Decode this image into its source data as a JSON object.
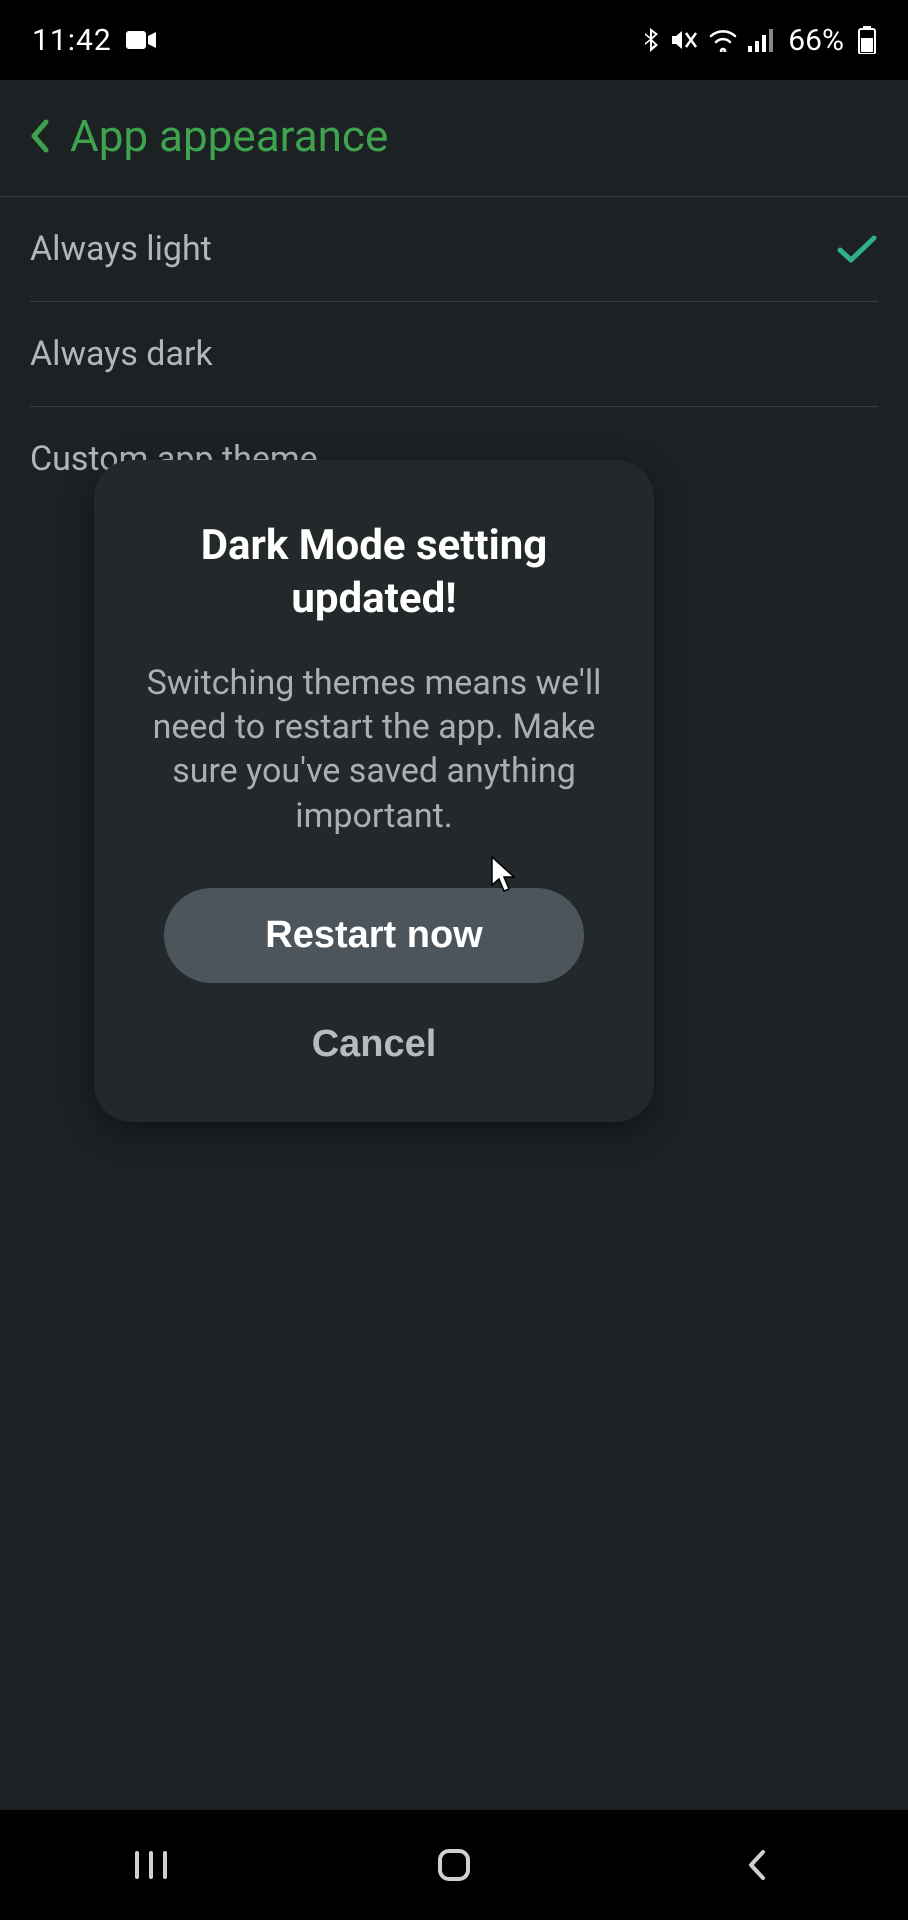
{
  "status_bar": {
    "time": "11:42",
    "battery_text": "66%"
  },
  "header": {
    "title": "App appearance"
  },
  "options": [
    {
      "label": "Always light",
      "selected": true
    },
    {
      "label": "Always dark",
      "selected": false
    },
    {
      "label": "Custom app theme",
      "selected": false
    }
  ],
  "dialog": {
    "title": "Dark Mode setting updated!",
    "body": "Switching themes means we'll need to restart the app. Make sure you've saved anything important.",
    "primary": "Restart now",
    "secondary": "Cancel"
  }
}
